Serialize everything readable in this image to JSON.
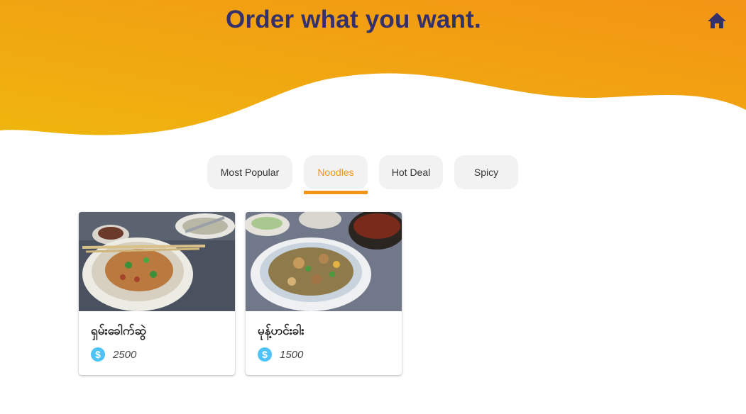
{
  "header": {
    "title": "Order what you want.",
    "home_icon": "home-icon",
    "gradient_colors": [
      "#f39414",
      "#efb50e"
    ],
    "title_color": "#34306b"
  },
  "tabs": {
    "items": [
      {
        "label": "Most Popular",
        "active": false
      },
      {
        "label": "Noodles",
        "active": true
      },
      {
        "label": "Hot Deal",
        "active": false
      },
      {
        "label": "Spicy",
        "active": false
      }
    ],
    "active_color": "#f39418"
  },
  "products": [
    {
      "name": "ရှမ်းခေါက်ဆွဲ",
      "price": "2500",
      "price_icon": "dollar-icon"
    },
    {
      "name": "မုန့်ဟင်းခါး",
      "price": "1500",
      "price_icon": "dollar-icon"
    }
  ]
}
